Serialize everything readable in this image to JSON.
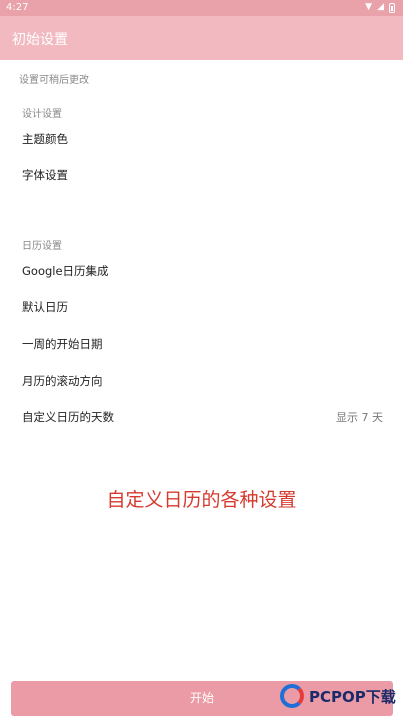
{
  "status_bar": {
    "time": "4:27"
  },
  "toolbar": {
    "title": "初始设置"
  },
  "hint": "设置可稍后更改",
  "design_section": {
    "header": "设计设置",
    "items": [
      {
        "label": "主题颜色"
      },
      {
        "label": "字体设置"
      }
    ]
  },
  "calendar_section": {
    "header": "日历设置",
    "items": [
      {
        "label": "Google日历集成"
      },
      {
        "label": "默认日历"
      },
      {
        "label": "一周的开始日期"
      },
      {
        "label": "月历的滚动方向"
      },
      {
        "label": "自定义日历的天数",
        "value": "显示 7 天"
      }
    ]
  },
  "banner_text": "自定义日历的各种设置",
  "start_button": {
    "label": "开始"
  },
  "watermark": {
    "text": "PCPOP下载"
  },
  "colors": {
    "toolbar": "#f2bac0",
    "status_bar": "#e9a1aa",
    "button": "#eb9ba6",
    "banner": "#d63a2e"
  }
}
